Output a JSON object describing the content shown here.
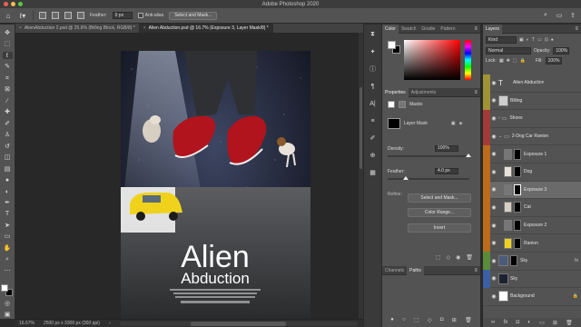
{
  "window": {
    "title": "Adobe Photoshop 2020"
  },
  "options": {
    "feather_label": "Feather:",
    "feather_value": "0 px",
    "antialias_label": "Anti-alias",
    "select_mask_label": "Select and Mask..."
  },
  "doc_tabs": [
    {
      "label": "AlienAbduction 2.psd @ 25.6% (Billing Block, RGB/8) *"
    },
    {
      "label": "Alien Abduction.psd @ 16.7% (Exposure 3, Layer Mask/8) *"
    }
  ],
  "artwork": {
    "title_line1": "Alien",
    "title_line2": "Abduction"
  },
  "status": {
    "zoom": "16.67%",
    "doc_size": "2500 px x 3300 px (300 ppi)"
  },
  "color_panel": {
    "tabs": [
      "Color",
      "Swatch",
      "Gradie",
      "Pattern"
    ],
    "foreground": "#ffffff",
    "background": "#000000"
  },
  "properties": {
    "tabs": [
      "Properties",
      "Adjustments"
    ],
    "masks_label": "Masks",
    "layer_mask_label": "Layer Mask",
    "density_label": "Density:",
    "density_value": "100%",
    "feather_label": "Feather:",
    "feather_value": "4.0 px",
    "refine_label": "Refine:",
    "btn_select_mask": "Select and Mask...",
    "btn_color_range": "Color Range...",
    "btn_invert": "Invert"
  },
  "channels": {
    "tabs": [
      "Channels",
      "Paths"
    ]
  },
  "layers_panel": {
    "tab": "Layers",
    "filter_kind": "Kind",
    "blend_mode": "Normal",
    "opacity_label": "Opacity:",
    "opacity_value": "100%",
    "lock_label": "Lock:",
    "fill_label": "Fill:",
    "fill_value": "100%",
    "layers": [
      {
        "name": "Alien Abduction",
        "kind": "text",
        "tag": "#a09334",
        "visible": true
      },
      {
        "name": "Billing",
        "kind": "image",
        "tag": "#a09334",
        "visible": true
      },
      {
        "name": "Shoes",
        "kind": "group",
        "tag": "#a33a3a",
        "visible": true
      },
      {
        "name": "2-Dog Car Ranion",
        "kind": "group",
        "tag": "#a33a3a",
        "visible": true
      },
      {
        "name": "Exposure 1",
        "kind": "adjust",
        "tag": "#bb6b1a",
        "visible": true
      },
      {
        "name": "Dog",
        "kind": "image",
        "tag": "#bb6b1a",
        "visible": true
      },
      {
        "name": "Exposure 3",
        "kind": "adjust",
        "tag": "#bb6b1a",
        "visible": true,
        "selected": true
      },
      {
        "name": "Cat",
        "kind": "image",
        "tag": "#bb6b1a",
        "visible": true
      },
      {
        "name": "Exposure 2",
        "kind": "adjust",
        "tag": "#bb6b1a",
        "visible": true
      },
      {
        "name": "Ranion",
        "kind": "image",
        "tag": "#bb6b1a",
        "visible": true
      },
      {
        "name": "Sky",
        "kind": "image",
        "tag": "#5b8c3a",
        "visible": true
      },
      {
        "name": "Sky",
        "kind": "image",
        "tag": "#3b5fa3",
        "visible": true
      },
      {
        "name": "Background",
        "kind": "image",
        "tag": "",
        "visible": true
      }
    ]
  }
}
